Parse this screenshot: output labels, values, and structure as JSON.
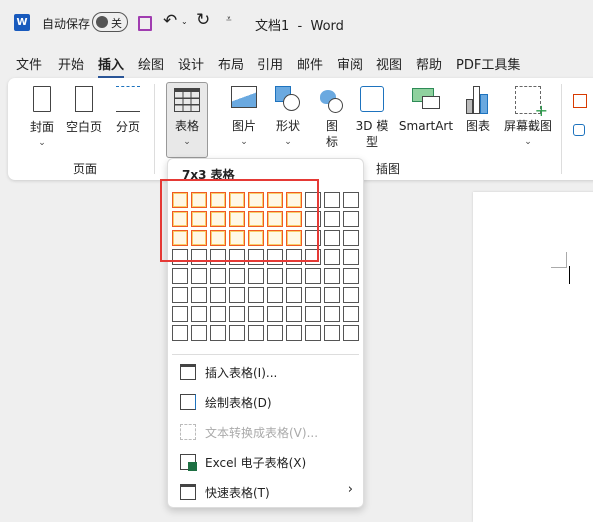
{
  "titlebar": {
    "autosave_label": "自动保存",
    "autosave_state": "关",
    "doc_title": "文档1  -  Word"
  },
  "tabs": [
    "文件",
    "开始",
    "插入",
    "绘图",
    "设计",
    "布局",
    "引用",
    "邮件",
    "审阅",
    "视图",
    "帮助",
    "PDF工具集"
  ],
  "active_tab": "插入",
  "ribbon": {
    "pages": {
      "items": [
        "封面",
        "空白页",
        "分页"
      ],
      "group": "页面"
    },
    "table": {
      "label": "表格"
    },
    "illustrations": {
      "items": [
        "图片",
        "形状",
        "图\n标",
        "3D 模\n型",
        "SmartArt",
        "图表",
        "屏幕截图"
      ],
      "group": "插图"
    }
  },
  "table_menu": {
    "header": "7x3 表格",
    "grid": {
      "columns": 10,
      "rows": 8,
      "selected_columns": 7,
      "selected_rows": 3
    },
    "items": [
      {
        "label": "插入表格(I)...",
        "enabled": true
      },
      {
        "label": "绘制表格(D)",
        "enabled": true
      },
      {
        "label": "文本转换成表格(V)...",
        "enabled": false
      },
      {
        "label": "Excel 电子表格(X)",
        "enabled": true
      },
      {
        "label": "快速表格(T)",
        "enabled": true,
        "submenu": true
      }
    ]
  },
  "colors": {
    "accent": "#2b579a",
    "selection_border": "#f05a24",
    "annotation": "#e53935"
  }
}
